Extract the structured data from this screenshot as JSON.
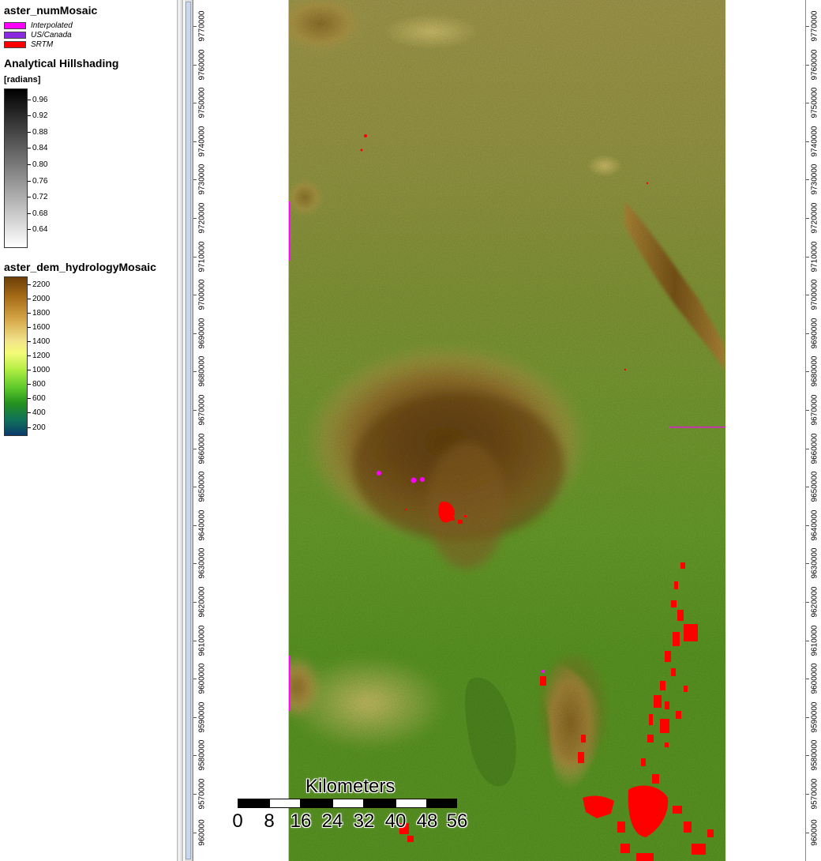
{
  "legend": {
    "num_mosaic": {
      "title": "aster_numMosaic",
      "items": [
        {
          "label": "Interpolated",
          "color": "#ff00ff"
        },
        {
          "label": "US/Canada",
          "color": "#8a2be2"
        },
        {
          "label": "SRTM",
          "color": "#ff0000"
        }
      ]
    },
    "hillshade": {
      "title": "Analytical Hillshading",
      "unit": "[radians]",
      "ticks": [
        "0.96",
        "0.92",
        "0.88",
        "0.84",
        "0.80",
        "0.76",
        "0.72",
        "0.68",
        "0.64"
      ],
      "ramp_colors": [
        "#000000",
        "#ffffff"
      ]
    },
    "dem": {
      "title": "aster_dem_hydrologyMosaic",
      "ticks": [
        "2200",
        "2000",
        "1800",
        "1600",
        "1400",
        "1200",
        "1000",
        "800",
        "600",
        "400",
        "200"
      ],
      "ramp_colors": [
        "#7a4a0c",
        "#b77b1c",
        "#e3c15a",
        "#fff27a",
        "#d6f75a",
        "#7ee02c",
        "#2e9a2a",
        "#0f6a6a",
        "#0c3f6a"
      ]
    }
  },
  "axis": {
    "labels": [
      "9770000",
      "9760000",
      "9750000",
      "9740000",
      "9730000",
      "9720000",
      "9710000",
      "9700000",
      "9690000",
      "9680000",
      "9670000",
      "9660000",
      "9650000",
      "9640000",
      "9630000",
      "9620000",
      "9610000",
      "9600000",
      "9590000",
      "9580000",
      "9570000",
      "960000"
    ]
  },
  "scalebar": {
    "title": "Kilometers",
    "labels": [
      "0",
      "8",
      "16",
      "24",
      "32",
      "40",
      "48",
      "56"
    ]
  },
  "colors": {
    "interpolated": "#ff00ff",
    "srtm": "#ff0000",
    "lowland": "#5e9a22",
    "plateau": "#8c9a3c",
    "mountain_core": "#6a4510"
  }
}
